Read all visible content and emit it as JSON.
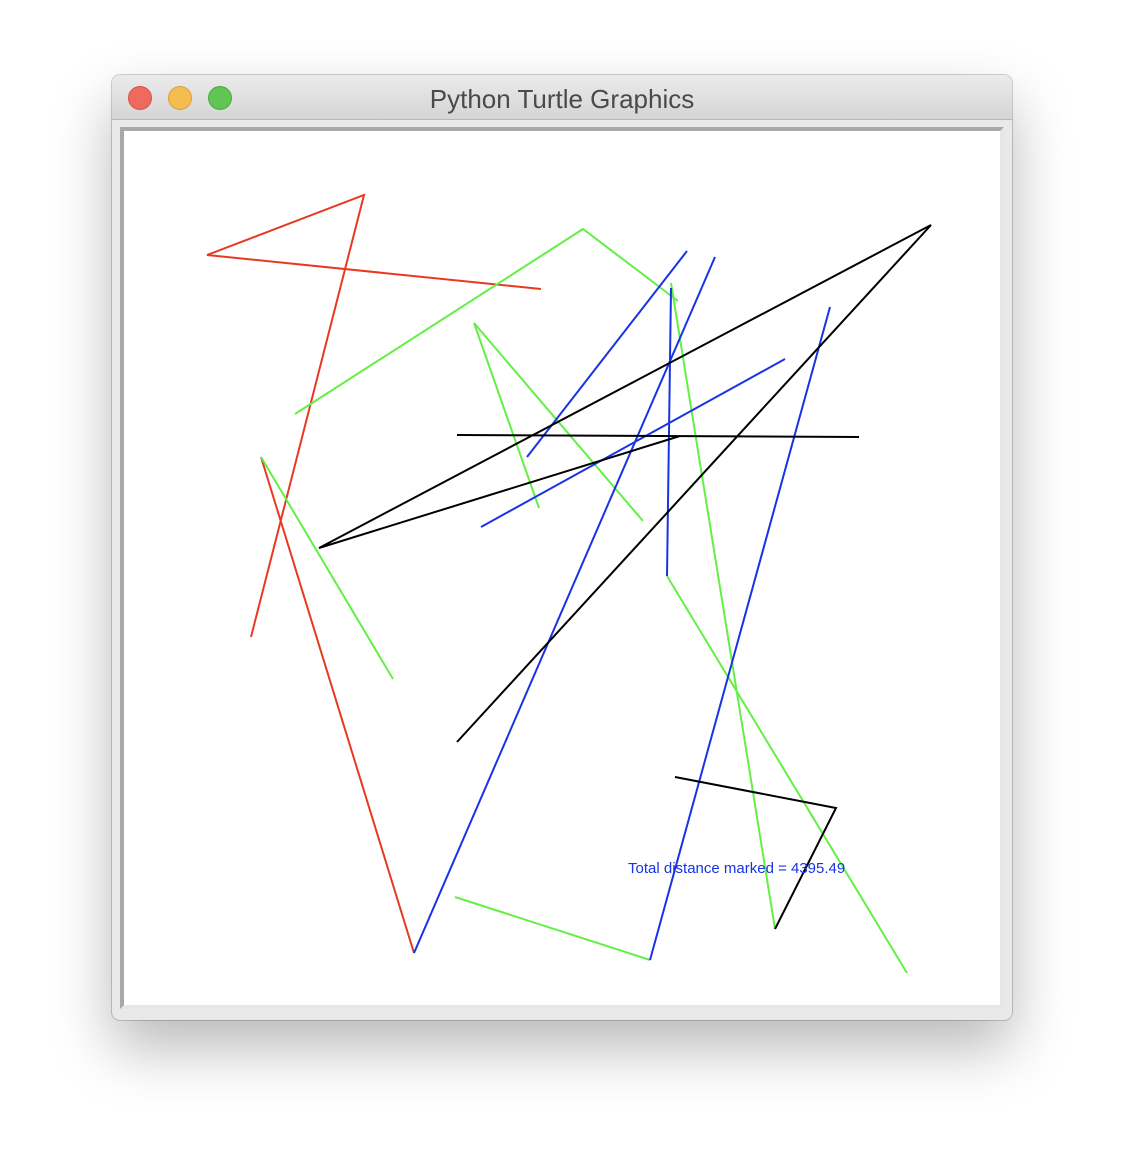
{
  "window": {
    "title": "Python Turtle Graphics"
  },
  "colors": {
    "red": "#e8391f",
    "green": "#62f044",
    "blue": "#1733e6",
    "black": "#000000",
    "readout": "#1733e6"
  },
  "readout": {
    "text": "Total distance marked = 4395.49"
  }
}
